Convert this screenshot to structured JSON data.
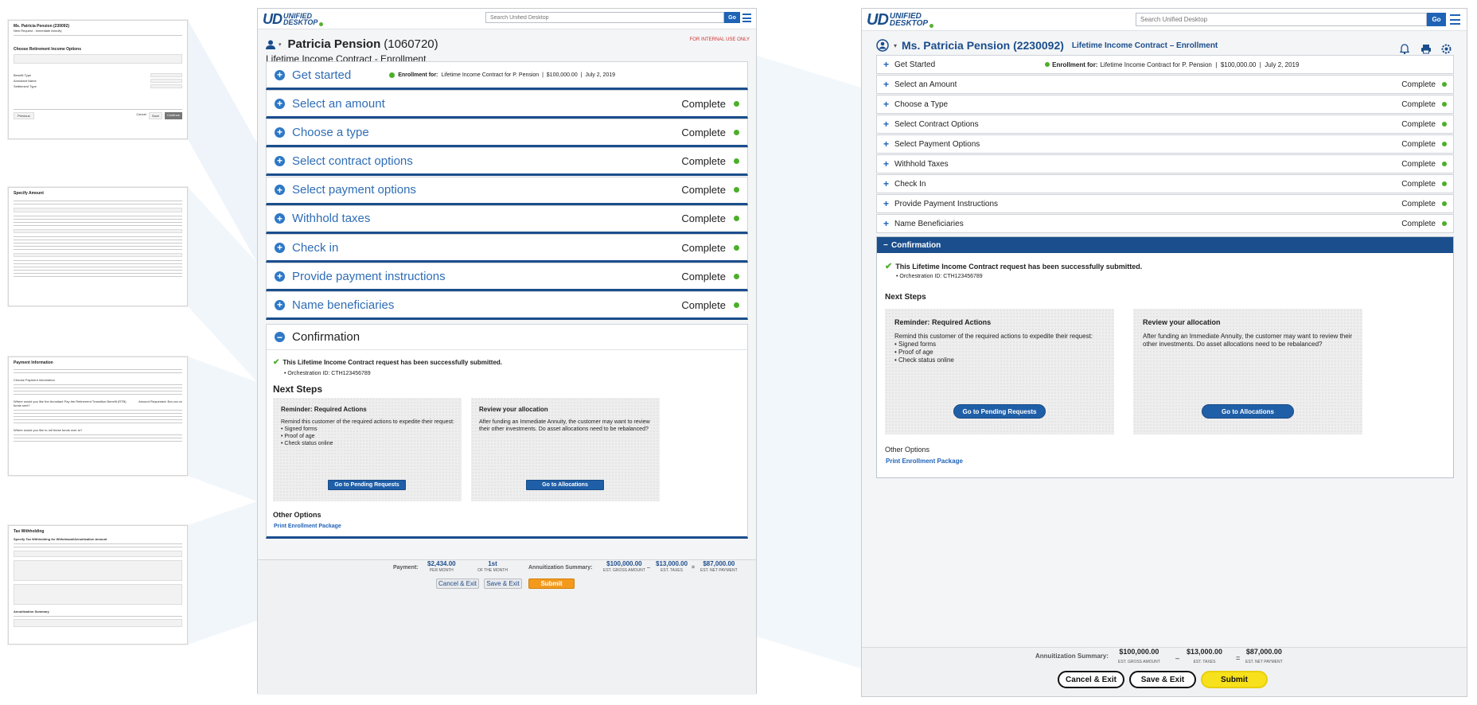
{
  "brand": {
    "mark": "UD",
    "line1": "UNIFIED",
    "line2": "DESKTOP"
  },
  "search": {
    "placeholder": "Search Unified Desktop",
    "go": "Go"
  },
  "thumbs": {
    "t1": {
      "name": "Ms. Patricia Pension (230092)",
      "sub": "New Request - Immediate Annuity",
      "section": "Choose Retirement Income Options",
      "f1": "Benefit Type",
      "f2": "Annuitant Name",
      "f3": "Settlement Type",
      "back": "Previous",
      "cancel": "Cancel",
      "save": "Save",
      "cont": "Continue"
    },
    "t2": {
      "title": "Specify Amount"
    },
    "t3": {
      "title": "Payment Information",
      "q1": "Choose Payment Information",
      "q2": "Where would you like the Annuitant Pay the Retirement Transition Benefit (RTB) funds sent?",
      "q3": "Where would you like to roll these funds over to?",
      "amt": "Amount Requested: $xx,xxx.xx"
    },
    "t4": {
      "title": "Tax Withholding",
      "sub": "Specify Tax Withholding for Withdrawal/Annuitization Amount",
      "sum": "Annuitization Summary"
    }
  },
  "mid": {
    "client_name": "Patricia Pension",
    "client_id": "(1060720)",
    "subtitle": "Lifetime Income Contract - Enrollment",
    "internal": "FOR INTERNAL USE ONLY",
    "get_started": "Get started",
    "enroll_label": "Enrollment for:",
    "enroll_detail": "Lifetime Income Contract for P. Pension  |  $100,000.00  |  July 2, 2019",
    "sections": [
      {
        "label": "Select an amount",
        "status": "Complete"
      },
      {
        "label": "Choose a type",
        "status": "Complete"
      },
      {
        "label": "Select contract options",
        "status": "Complete"
      },
      {
        "label": "Select payment options",
        "status": "Complete"
      },
      {
        "label": "Withhold taxes",
        "status": "Complete"
      },
      {
        "label": "Check in",
        "status": "Complete"
      },
      {
        "label": "Provide payment instructions",
        "status": "Complete"
      },
      {
        "label": "Name beneficiaries",
        "status": "Complete"
      }
    ],
    "confirmation": "Confirmation",
    "success": "This Lifetime Income Contract request has been successfully submitted.",
    "orch": "Orchestration ID: CTH123456789",
    "next_steps": "Next Steps",
    "card1": {
      "title": "Reminder: Required Actions",
      "body": "Remind this customer of the required actions to expedite their request:",
      "items": [
        "• Signed forms",
        "• Proof of age",
        "• Check status online"
      ],
      "button": "Go to Pending Requests"
    },
    "card2": {
      "title": "Review your allocation",
      "body": "After funding an Immediate Annuity, the customer may want to review their other investments. Do asset allocations need to be rebalanced?",
      "button": "Go to Allocations"
    },
    "other_options": "Other Options",
    "print_link": "Print Enrollment Package",
    "footer": {
      "payment_label": "Payment:",
      "payment_amount": "$2,434.00",
      "per_month": "PER MONTH",
      "day": "1st",
      "of_month": "OF THE MONTH",
      "summary_label": "Annuitization Summary:",
      "gross": "$100,000.00",
      "gross_cap": "EST. GROSS AMOUNT",
      "minus": "–",
      "taxes": "$13,000.00",
      "taxes_cap": "EST. TAXES",
      "eq": "=",
      "net": "$87,000.00",
      "net_cap": "EST. NET PAYMENT",
      "cancel": "Cancel & Exit",
      "save": "Save & Exit",
      "submit": "Submit"
    }
  },
  "right": {
    "salutation": "Ms. Patricia Pension (2230092)",
    "subtitle": "Lifetime Income Contract – Enrollment",
    "get_started": "Get Started",
    "enroll_label": "Enrollment for:",
    "enroll_detail": "Lifetime Income Contract for P. Pension  |  $100,000.00  |  July 2, 2019",
    "sections": [
      {
        "label": "Select an Amount",
        "status": "Complete"
      },
      {
        "label": "Choose a Type",
        "status": "Complete"
      },
      {
        "label": "Select Contract Options",
        "status": "Complete"
      },
      {
        "label": "Select Payment Options",
        "status": "Complete"
      },
      {
        "label": "Withhold Taxes",
        "status": "Complete"
      },
      {
        "label": "Check In",
        "status": "Complete"
      },
      {
        "label": "Provide Payment Instructions",
        "status": "Complete"
      },
      {
        "label": "Name Beneficiaries",
        "status": "Complete"
      }
    ],
    "confirmation": "Confirmation",
    "success": "This Lifetime Income Contract request has been successfully submitted.",
    "orch": "Orchestration ID: CTH123456789",
    "next_steps": "Next Steps",
    "card1": {
      "title": "Reminder: Required Actions",
      "body": "Remind this customer of the required actions to expedite their request:",
      "items": [
        "• Signed forms",
        "• Proof of age",
        "• Check status online"
      ],
      "button": "Go to Pending Requests"
    },
    "card2": {
      "title": "Review your allocation",
      "body": "After funding an Immediate Annuity, the customer may want to review their other investments. Do asset allocations need to be rebalanced?",
      "button": "Go to Allocations"
    },
    "other_options": "Other Options",
    "print_link": "Print Enrollment Package",
    "footer": {
      "summary_label": "Annuitization Summary:",
      "gross": "$100,000.00",
      "gross_cap": "EST. GROSS AMOUNT",
      "minus": "–",
      "taxes": "$13,000.00",
      "taxes_cap": "EST. TAXES",
      "eq": "=",
      "net": "$87,000.00",
      "net_cap": "EST. NET PAYMENT",
      "cancel": "Cancel & Exit",
      "save": "Save & Exit",
      "submit": "Submit"
    }
  },
  "colors": {
    "brand_blue": "#1b4e8c",
    "link_blue": "#2f6db5",
    "complete_green": "#4caf2a",
    "submit_orange": "#f39a1d",
    "submit_yellow": "#f7e01c",
    "internal_red": "#d0312d"
  }
}
